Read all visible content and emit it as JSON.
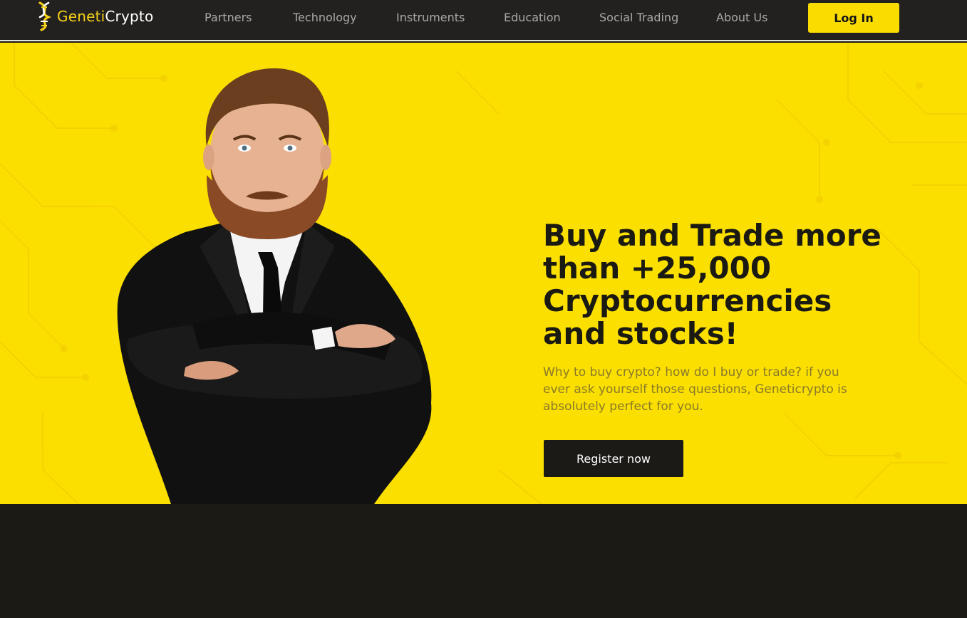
{
  "brand": {
    "name_part1": "Geneti",
    "name_part2": "Crypto",
    "accent_color": "#fbdf00",
    "icon": "dna-helix-icon"
  },
  "nav": {
    "items": [
      {
        "label": "Partners"
      },
      {
        "label": "Technology"
      },
      {
        "label": "Instruments"
      },
      {
        "label": "Education"
      },
      {
        "label": "Social Trading"
      },
      {
        "label": "About Us"
      }
    ],
    "login_label": "Log In"
  },
  "hero": {
    "headline": "Buy and Trade more than +25,000 Cryptocurrencies and stocks!",
    "subtext": "Why to buy crypto? how do I buy or trade? if you ever ask yourself those questions, Geneticrypto is absolutely perfect for you.",
    "cta_label": "Register now",
    "background_color": "#fbdf00",
    "image": "businessman-crossed-arms"
  },
  "colors": {
    "navbar": "#222120",
    "dark": "#1b1a14",
    "nav_text": "#a9a9a4"
  }
}
